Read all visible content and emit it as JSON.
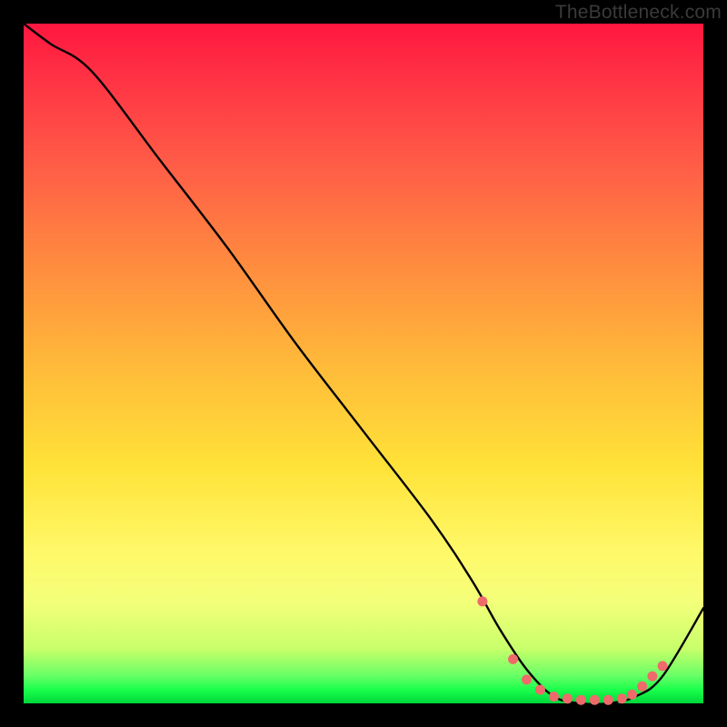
{
  "watermark": "TheBottleneck.com",
  "chart_data": {
    "type": "line",
    "title": "",
    "xlabel": "",
    "ylabel": "",
    "xlim": [
      0,
      100
    ],
    "ylim": [
      0,
      100
    ],
    "series": [
      {
        "name": "curve",
        "x": [
          0,
          4,
          10,
          20,
          30,
          40,
          50,
          60,
          66,
          70,
          74,
          78,
          82,
          86,
          90,
          94,
          100
        ],
        "y": [
          100,
          97,
          93,
          80,
          67,
          53,
          40,
          27,
          18,
          11,
          5,
          1,
          0,
          0,
          1,
          4,
          14
        ]
      }
    ],
    "markers": {
      "name": "dots",
      "color": "#ef6a6a",
      "x": [
        67.5,
        72,
        74,
        76,
        78,
        80,
        82,
        84,
        86,
        88,
        89.5,
        91,
        92.5,
        94
      ],
      "y": [
        15,
        6.5,
        3.5,
        2,
        1,
        0.7,
        0.5,
        0.5,
        0.5,
        0.7,
        1.3,
        2.5,
        4,
        5.5
      ]
    }
  }
}
